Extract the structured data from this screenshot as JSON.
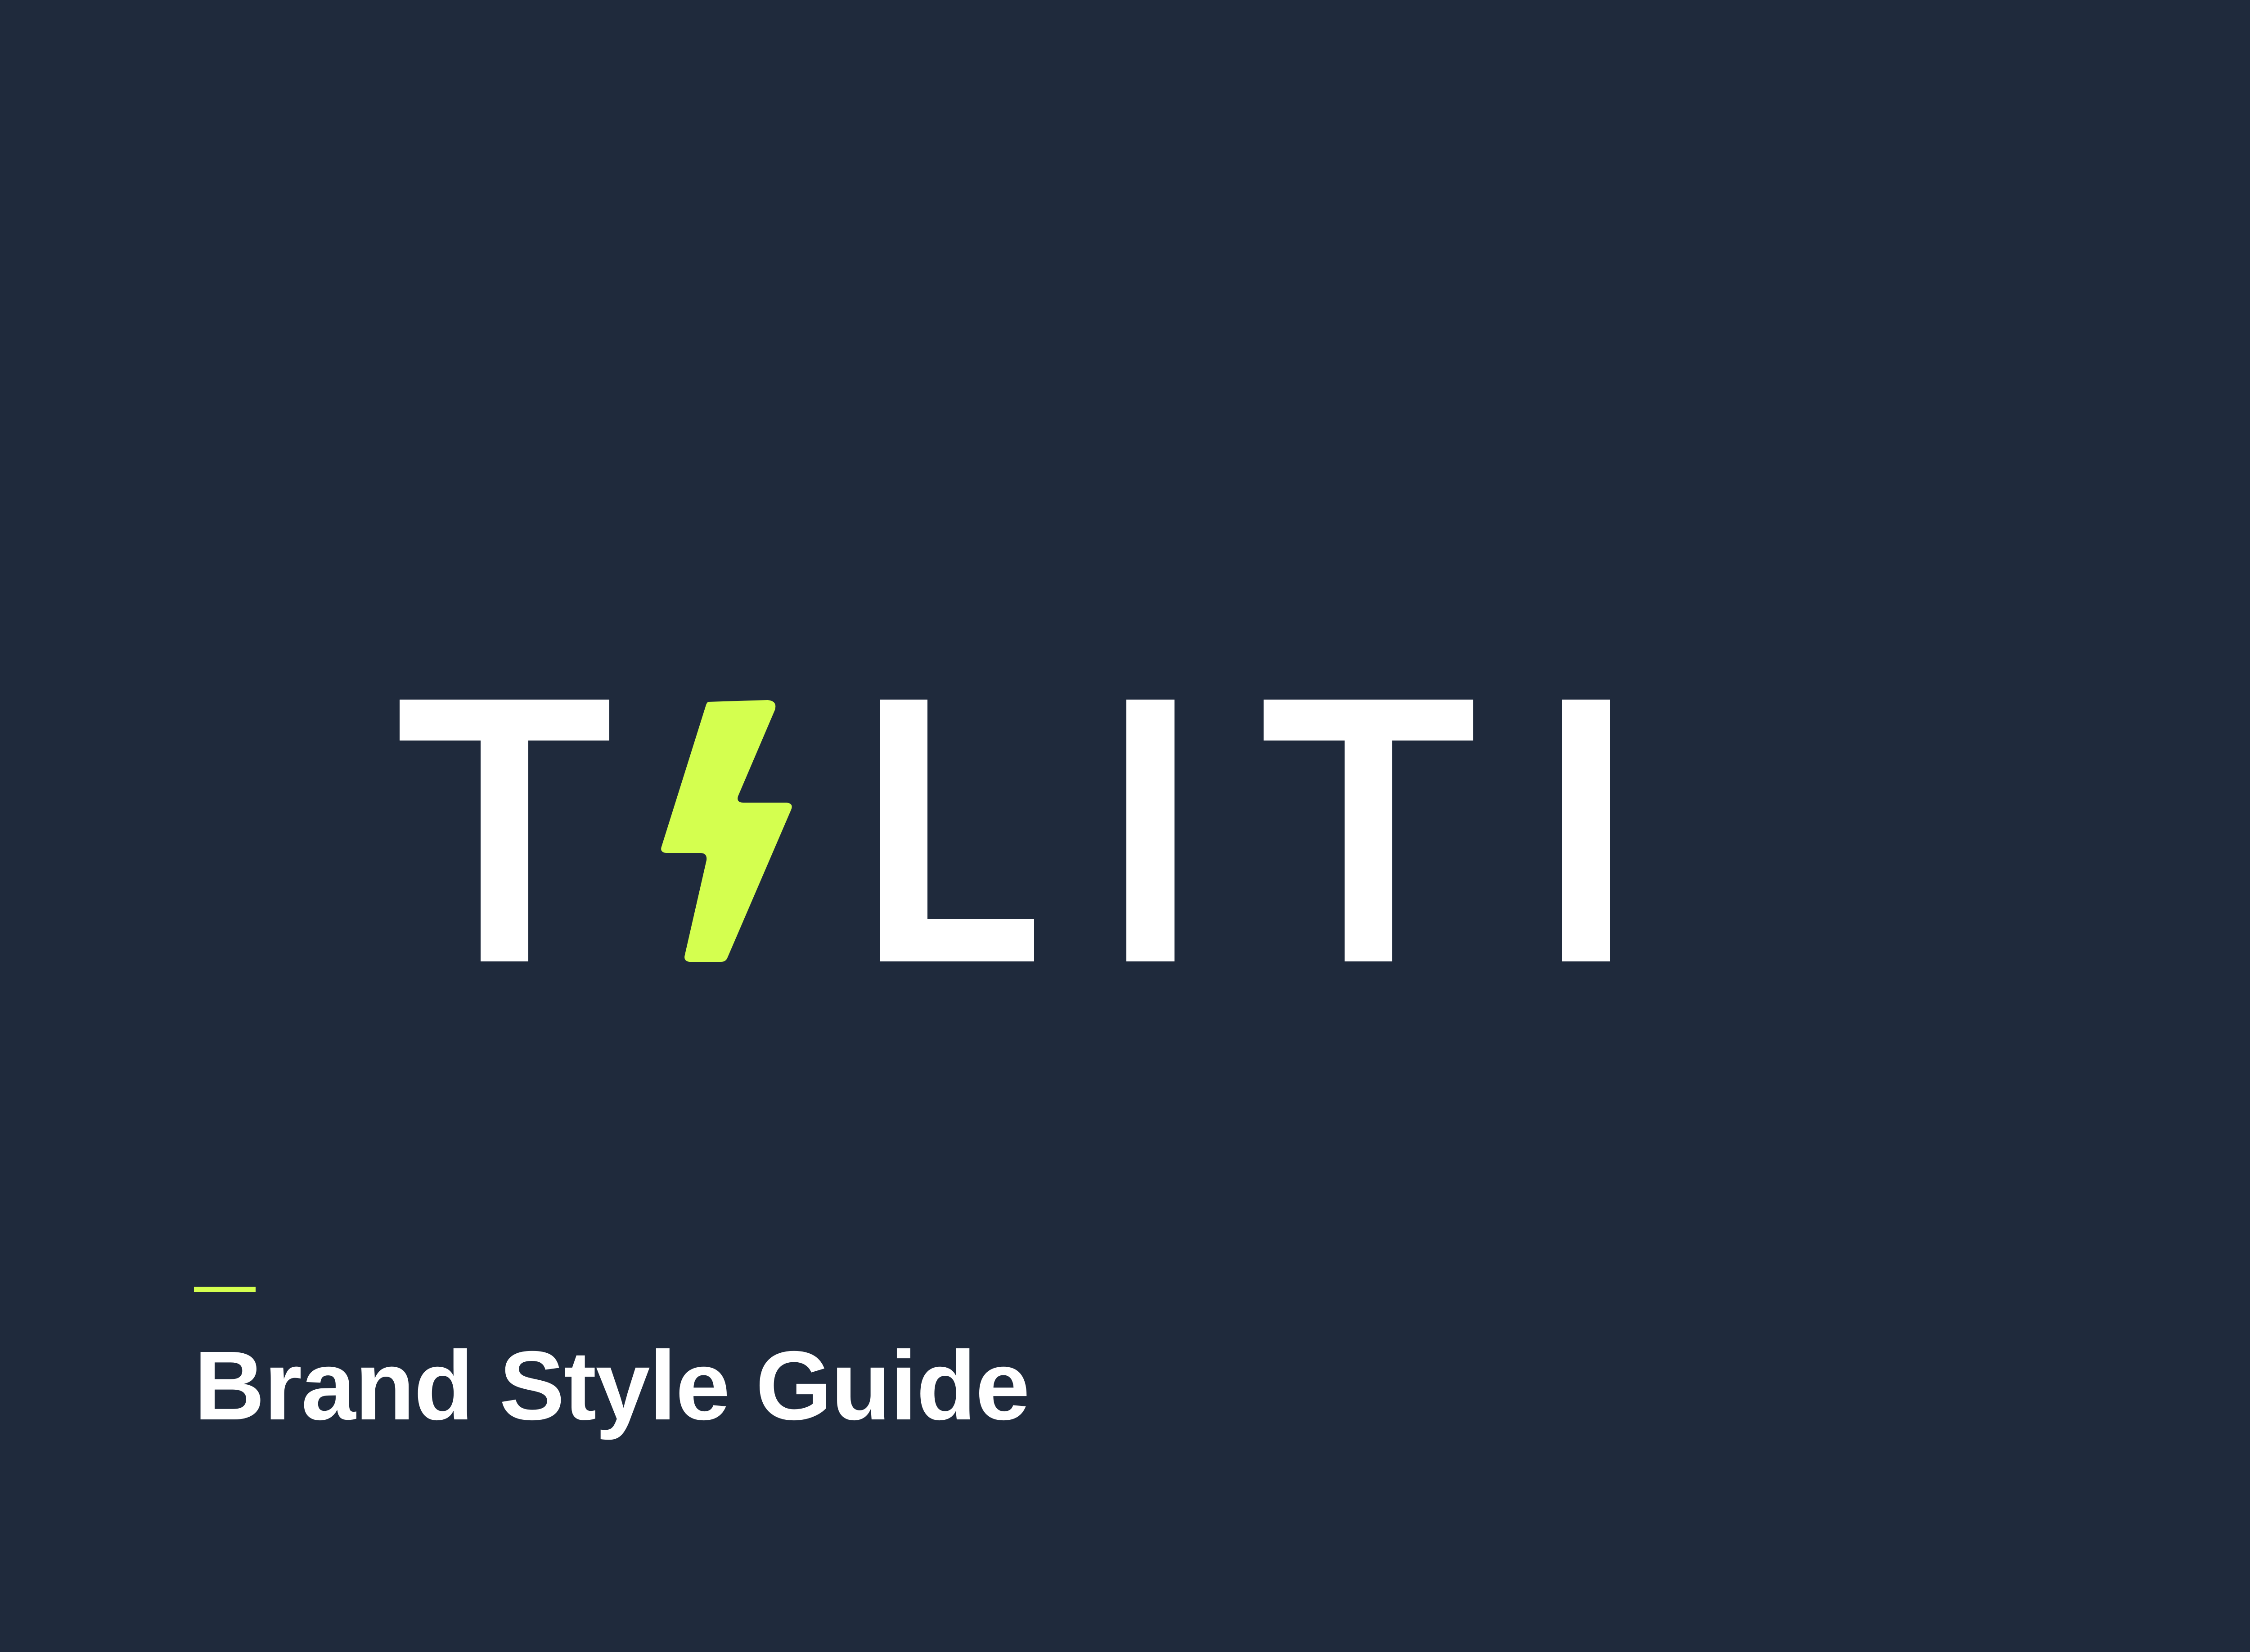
{
  "cover": {
    "wordmark": "TALITI",
    "subtitle": "Brand Style Guide"
  },
  "colors": {
    "background": "#1F2A3C",
    "wordmark": "#FFFFFF",
    "accent": "#D4FF4F"
  },
  "icons": {
    "wordmark_a": "lightning-bolt-icon"
  }
}
